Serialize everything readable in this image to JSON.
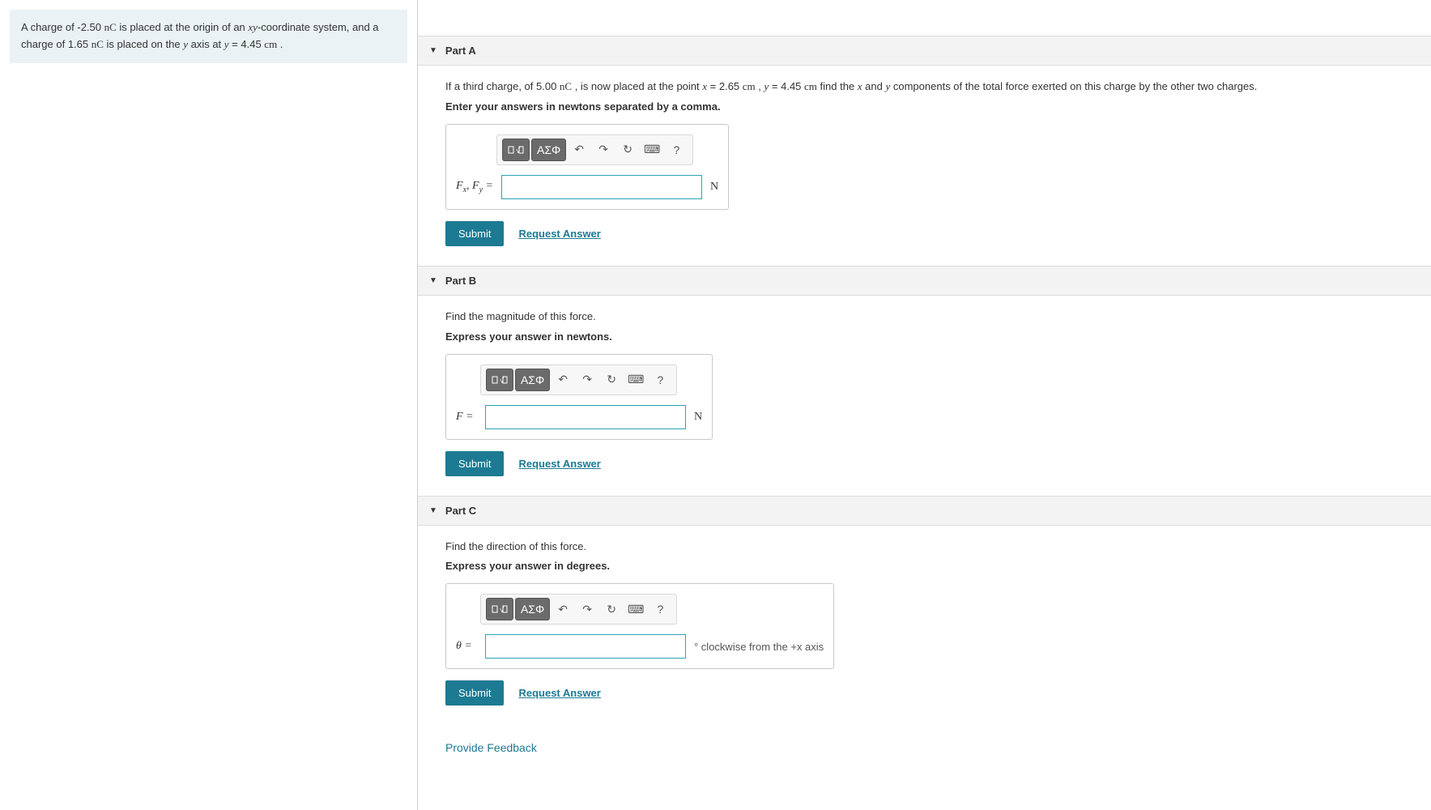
{
  "problem": {
    "text_pre": "A charge of -2.50 ",
    "unit1": "nC",
    "text_mid1": " is placed at the origin of an ",
    "xy": "xy",
    "text_mid2": "-coordinate system, and a charge of 1.65 ",
    "unit2": "nC",
    "text_mid3": " is placed on the ",
    "yvar": "y",
    "text_mid4": " axis at ",
    "yeq": "y",
    "text_mid5": " = 4.45 ",
    "unit3": "cm",
    "text_end": " ."
  },
  "parts": {
    "a": {
      "title": "Part A",
      "q_pre": "If a third charge, of 5.00 ",
      "q_u1": "nC",
      "q_mid1": " , is now placed at the point ",
      "q_x": "x",
      "q_mid2": " = 2.65 ",
      "q_u2": "cm",
      "q_mid3": " , ",
      "q_y": "y",
      "q_mid4": " = 4.45 ",
      "q_u3": "cm",
      "q_mid5": " find the ",
      "q_x2": "x",
      "q_mid6": " and ",
      "q_y2": "y",
      "q_end": " components of the total force exerted on this charge by the other two charges.",
      "instr": "Enter your answers in newtons separated by a comma.",
      "var_label": "Fx, Fy =",
      "unit": "N",
      "input_width": 248
    },
    "b": {
      "title": "Part B",
      "q": "Find the magnitude of this force.",
      "instr": "Express your answer in newtons.",
      "var_label": "F =",
      "unit": "N",
      "input_width": 248
    },
    "c": {
      "title": "Part C",
      "q": "Find the direction of this force.",
      "instr": "Express your answer in degrees.",
      "var_label": "θ =",
      "unit_suffix": "° clockwise from the +x axis",
      "input_width": 248
    }
  },
  "toolbar": {
    "template_label": "template",
    "greek_label": "ΑΣΦ",
    "undo": "↶",
    "redo": "↷",
    "reset": "↻",
    "keyboard": "⌨",
    "help": "?"
  },
  "buttons": {
    "submit": "Submit",
    "request": "Request Answer",
    "feedback": "Provide Feedback"
  }
}
